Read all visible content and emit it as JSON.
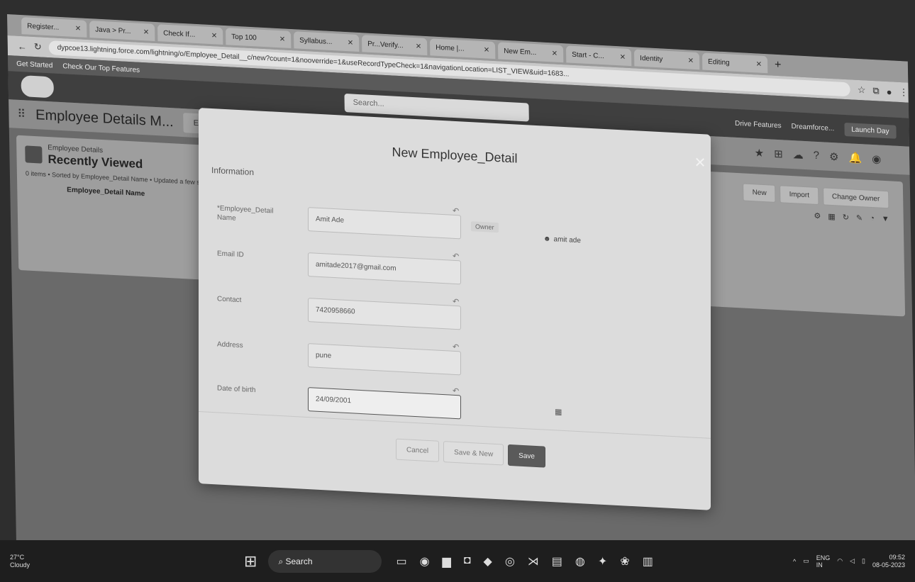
{
  "browser": {
    "tabs": [
      "Register...",
      "Java > Pr...",
      "Check If...",
      "Top 100",
      "Syllabus...",
      "Pr...Verify...",
      "Home |...",
      "New Em...",
      "Start - C...",
      "Identity",
      "Editing"
    ],
    "new_tab": "+",
    "url": "dypcoe13.lightning.force.com/lightning/o/Employee_Detail__c/new?count=1&nooverride=1&useRecordTypeCheck=1&navigationLocation=LIST_VIEW&uid=1683...",
    "bookmarks": [
      "Get Started",
      "Check Our Top Features"
    ]
  },
  "salesforce": {
    "search_placeholder": "Search...",
    "header_right": [
      "Drive Features",
      "Dreamforce..."
    ],
    "header_button": "Launch Day",
    "app_name": "Employee Details M...",
    "app_tab": "Employee_D...",
    "list": {
      "object": "Employee Details",
      "title": "Recently Viewed",
      "meta": "0 items • Sorted by Employee_Detail Name • Updated a few seconds ago",
      "column": "Employee_Detail Name",
      "actions": [
        "New",
        "Import",
        "Change Owner"
      ]
    }
  },
  "modal": {
    "title": "New Employee_Detail",
    "close": "✕",
    "section": "Information",
    "fields": [
      {
        "label": "*Employee_Detail Name",
        "value": "Amit Ade"
      },
      {
        "label": "Email ID",
        "value": "amitade2017@gmail.com"
      },
      {
        "label": "Contact",
        "value": "7420958660"
      },
      {
        "label": "Address",
        "value": "pune"
      },
      {
        "label": "Date of birth",
        "value": "24/09/2001"
      }
    ],
    "owner_label": "Owner",
    "owner_value": "amit ade",
    "buttons": {
      "cancel": "Cancel",
      "save_new": "Save & New",
      "save": "Save"
    }
  },
  "taskbar": {
    "weather_temp": "27°C",
    "weather_desc": "Cloudy",
    "search": "Search",
    "lang": "ENG",
    "lang_region": "IN",
    "time": "09:52",
    "date": "08-05-2023"
  }
}
